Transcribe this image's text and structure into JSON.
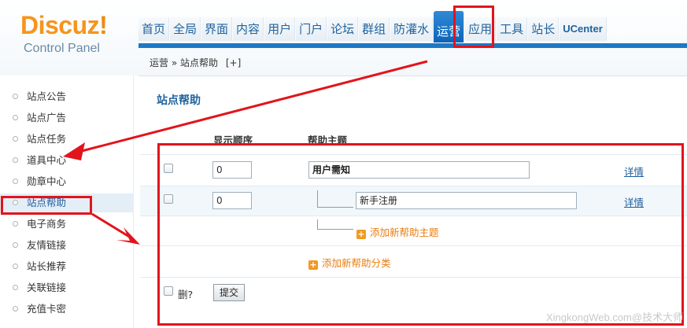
{
  "logo": {
    "word": "Discuz",
    "bang": "!",
    "subtitle": "Control Panel"
  },
  "nav": {
    "items": [
      {
        "label": "首页",
        "active": false
      },
      {
        "label": "全局",
        "active": false
      },
      {
        "label": "界面",
        "active": false
      },
      {
        "label": "内容",
        "active": false
      },
      {
        "label": "用户",
        "active": false
      },
      {
        "label": "门户",
        "active": false
      },
      {
        "label": "论坛",
        "active": false
      },
      {
        "label": "群组",
        "active": false
      },
      {
        "label": "防灌水",
        "active": false
      },
      {
        "label": "运营",
        "active": true
      },
      {
        "label": "应用",
        "active": false
      },
      {
        "label": "工具",
        "active": false
      },
      {
        "label": "站长",
        "active": false
      },
      {
        "label": "UCenter",
        "active": false
      }
    ]
  },
  "breadcrumb": {
    "section": "运营",
    "separator": "»",
    "page": "站点帮助",
    "add": "[+]"
  },
  "sidebar": {
    "items": [
      {
        "label": "站点公告"
      },
      {
        "label": "站点广告"
      },
      {
        "label": "站点任务"
      },
      {
        "label": "道具中心"
      },
      {
        "label": "勋章中心"
      },
      {
        "label": "站点帮助",
        "active": true
      },
      {
        "label": "电子商务"
      },
      {
        "label": "友情链接"
      },
      {
        "label": "站长推荐"
      },
      {
        "label": "关联链接"
      },
      {
        "label": "充值卡密"
      }
    ]
  },
  "main": {
    "title": "站点帮助",
    "columns": {
      "order": "显示顺序",
      "topic": "帮助主题"
    },
    "rows": [
      {
        "order": "0",
        "topic": "用户需知",
        "detail": "详情"
      },
      {
        "order": "0",
        "topic": "新手注册",
        "detail": "详情"
      }
    ],
    "add_topic": "添加新帮助主题",
    "add_category": "添加新帮助分类",
    "delete_label": "删?",
    "submit_label": "提交"
  },
  "annotation": {
    "color": "#e2141b"
  },
  "watermark": "XingkongWeb.com@技术大师",
  "colors": {
    "brand_orange": "#f7941d",
    "nav_blue": "#1d78c5",
    "link_blue": "#1d5d9b",
    "add_orange": "#e87d10"
  }
}
